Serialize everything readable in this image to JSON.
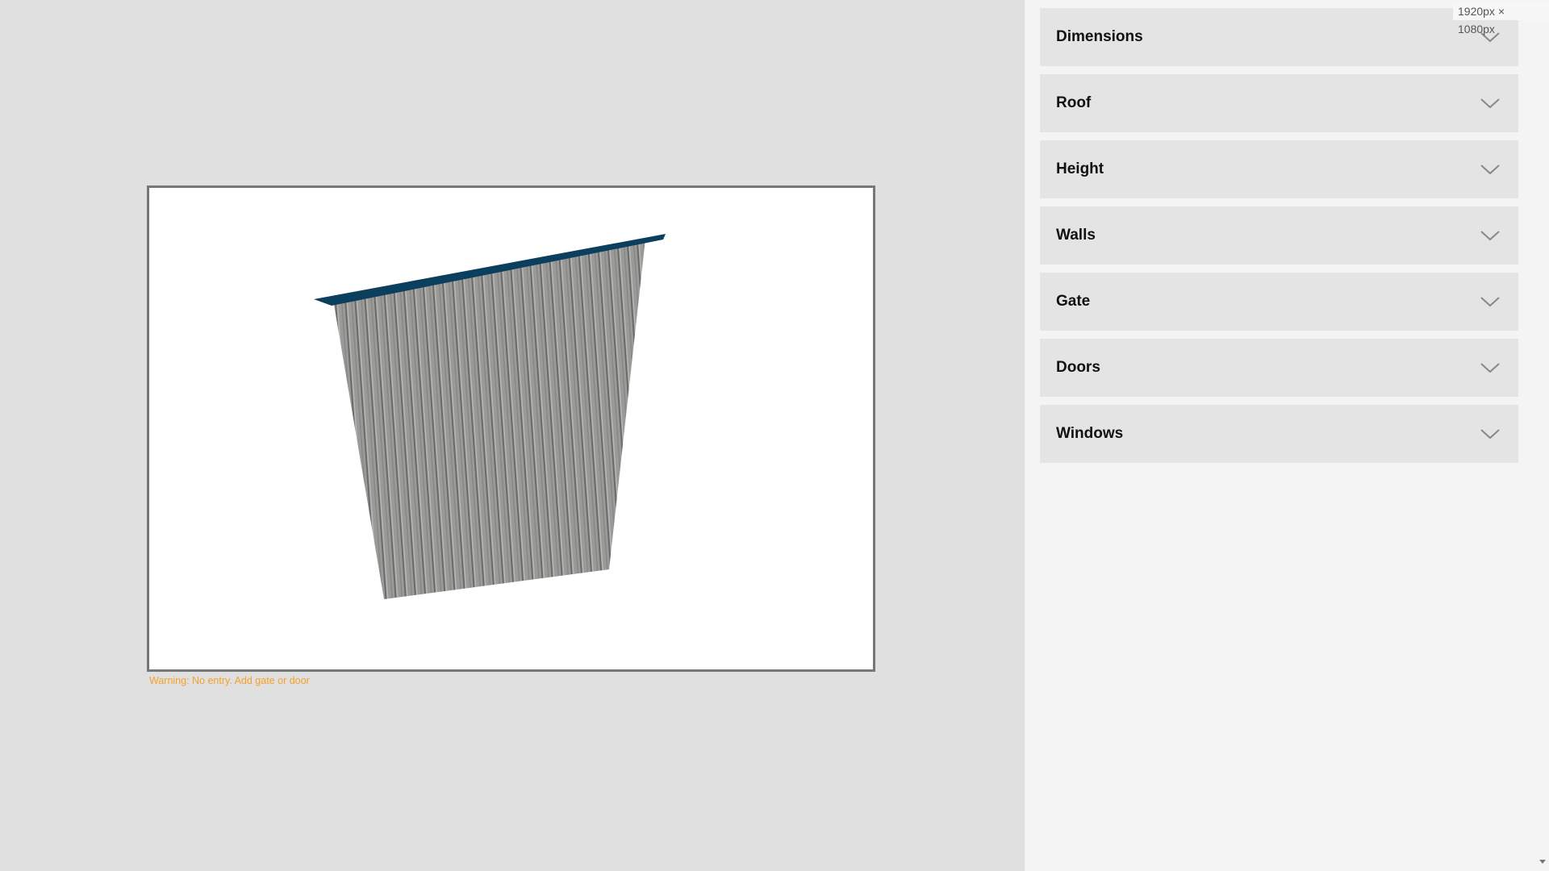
{
  "dimension_badge": "1920px × 1080px",
  "warning": "Warning: No entry. Add gate or door",
  "colors": {
    "roof": "#0c3f5e",
    "wall": "#9a9b98",
    "warning": "#f5a02a",
    "viewport_border": "#777777"
  },
  "sections": [
    {
      "label": "Dimensions",
      "icon": "chevron-down-icon"
    },
    {
      "label": "Roof",
      "icon": "chevron-down-icon"
    },
    {
      "label": "Height",
      "icon": "chevron-down-icon"
    },
    {
      "label": "Walls",
      "icon": "chevron-down-icon"
    },
    {
      "label": "Gate",
      "icon": "chevron-down-icon"
    },
    {
      "label": "Doors",
      "icon": "chevron-down-icon"
    },
    {
      "label": "Windows",
      "icon": "chevron-down-icon"
    }
  ]
}
